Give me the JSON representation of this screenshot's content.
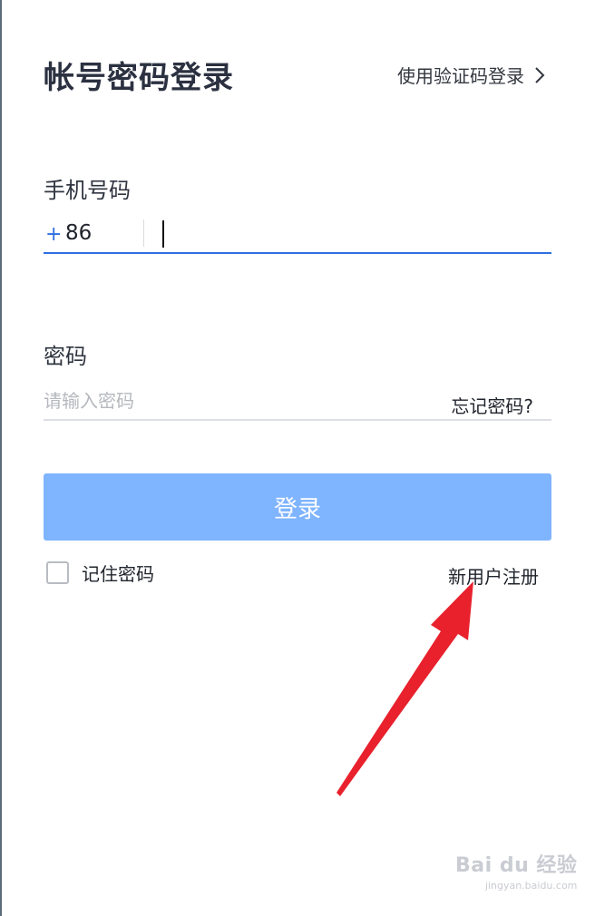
{
  "header": {
    "title": "帐号密码登录",
    "switch_label": "使用验证码登录"
  },
  "phone": {
    "label": "手机号码",
    "country_code_plus": "+",
    "country_code": "86",
    "value": ""
  },
  "password": {
    "label": "密码",
    "placeholder": "请输入密码",
    "forgot_label": "忘记密码?"
  },
  "login_button": "登录",
  "remember": {
    "label": "记住密码",
    "checked": false
  },
  "register_label": "新用户注册",
  "watermark": {
    "main": "Bai du 经验",
    "sub": "jingyan.baidu.com"
  },
  "colors": {
    "accent": "#2e6fe0",
    "button": "#7fb4ff",
    "annotation_arrow": "#e8212d"
  },
  "icons": {
    "switch_chevron": "chevron-right-icon",
    "annotation": "red-arrow-icon",
    "watermark_logo": "baidu-paw-icon"
  }
}
